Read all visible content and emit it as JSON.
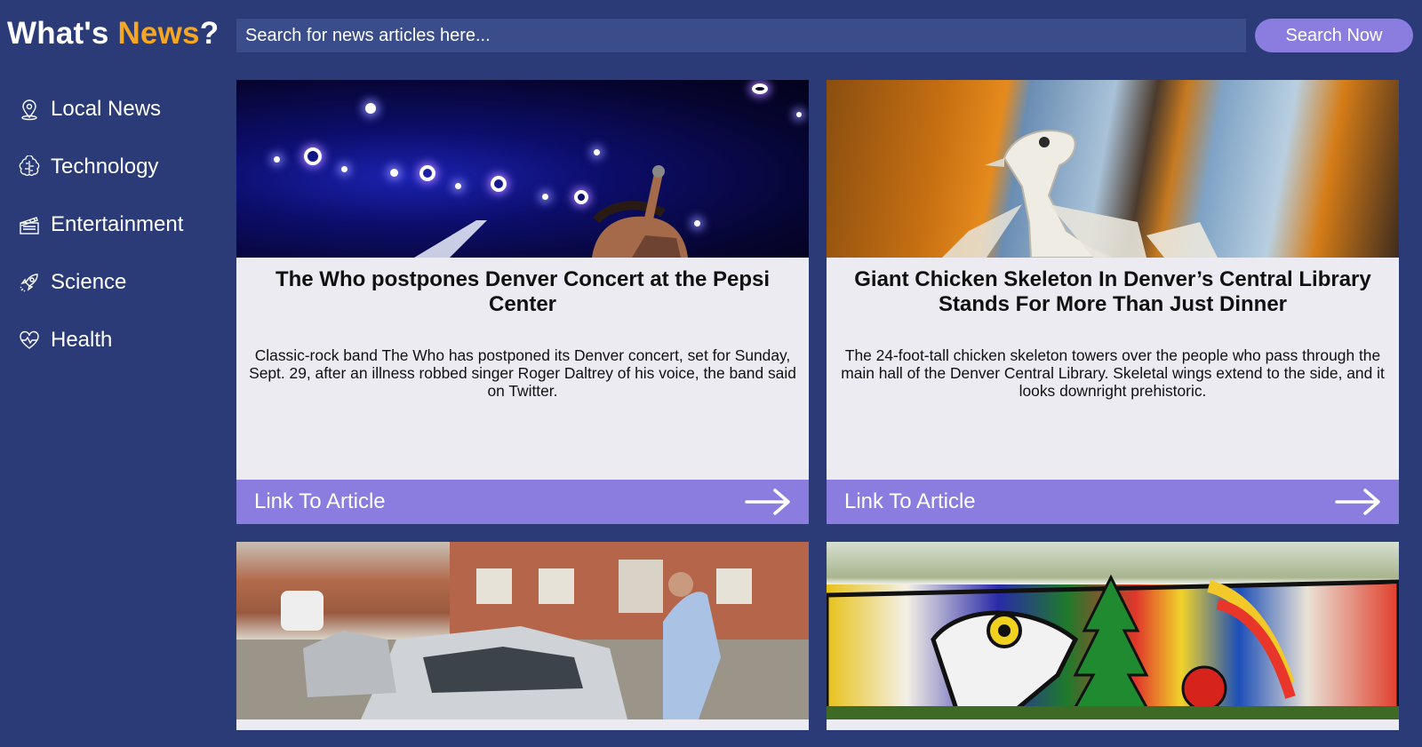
{
  "header": {
    "logo_part1": "What's ",
    "logo_accent": "News",
    "logo_part2": "?",
    "search_placeholder": "Search for news articles here...",
    "search_button": "Search Now"
  },
  "sidebar": {
    "items": [
      {
        "label": "Local News",
        "icon": "map-pin-icon"
      },
      {
        "label": "Technology",
        "icon": "brain-icon"
      },
      {
        "label": "Entertainment",
        "icon": "clapperboard-icon"
      },
      {
        "label": "Science",
        "icon": "rocket-icon"
      },
      {
        "label": "Health",
        "icon": "heartbeat-icon"
      }
    ]
  },
  "articles": [
    {
      "title": "The Who postpones Denver Concert at the Pepsi Center",
      "description": "Classic-rock band The Who has postponed its Denver concert, set for Sunday, Sept. 29, after an illness robbed singer Roger Daltrey of his voice, the band said on Twitter.",
      "link_label": "Link To Article"
    },
    {
      "title": "Giant Chicken Skeleton In Denver’s Central Library Stands For More Than Just Dinner",
      "description": "The 24-foot-tall chicken skeleton towers over the people who pass through the main hall of the Denver Central Library. Skeletal wings extend to the side, and it looks downright prehistoric.",
      "link_label": "Link To Article"
    },
    {
      "title": "",
      "description": "",
      "link_label": ""
    },
    {
      "title": "",
      "description": "",
      "link_label": ""
    }
  ],
  "colors": {
    "background": "#2a3b78",
    "accent": "#f5a623",
    "button": "#8b7de0",
    "card": "#ebebf1"
  }
}
